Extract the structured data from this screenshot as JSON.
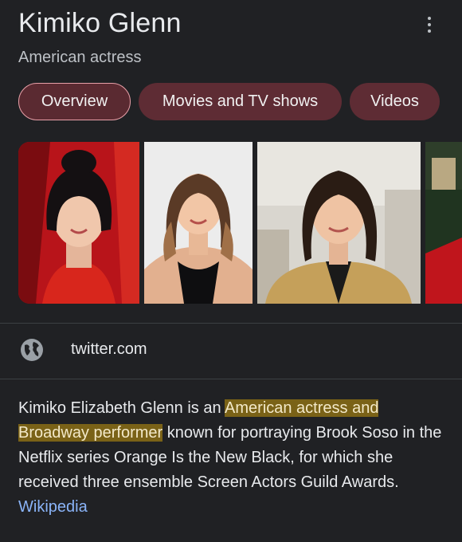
{
  "header": {
    "title": "Kimiko Glenn",
    "subtitle": "American actress",
    "more_icon": "more-vert-icon"
  },
  "tabs": [
    {
      "label": "Overview",
      "active": true
    },
    {
      "label": "Movies and TV shows",
      "active": false
    },
    {
      "label": "Videos",
      "active": false
    }
  ],
  "images": [
    {
      "alt": "Kimiko Glenn photo 1"
    },
    {
      "alt": "Kimiko Glenn photo 2"
    },
    {
      "alt": "Kimiko Glenn photo 3"
    },
    {
      "alt": "Kimiko Glenn photo 4"
    }
  ],
  "source": {
    "icon": "globe-icon",
    "domain": "twitter.com"
  },
  "description": {
    "before": "Kimiko Elizabeth Glenn is an ",
    "highlight": "American actress and Broadway performer",
    "after": " known for portraying Brook Soso in the Netflix series Orange Is the New Black, for which she received three ensemble Screen Actors Guild Awards. ",
    "link": "Wikipedia"
  },
  "colors": {
    "background": "#202124",
    "chip": "#5e2c34",
    "highlight": "#7a6217",
    "link": "#8ab4f8"
  }
}
